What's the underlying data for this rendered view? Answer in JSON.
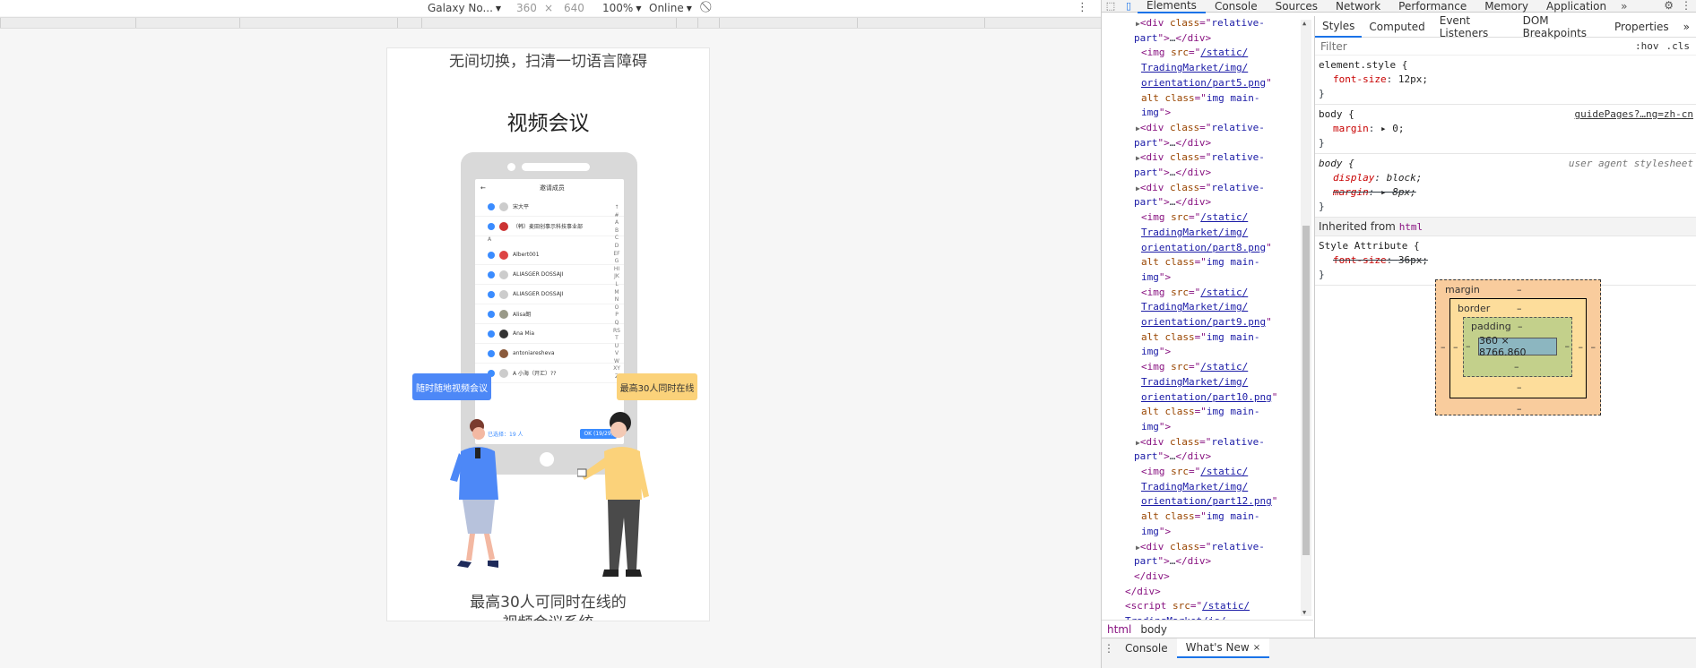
{
  "device_toolbar": {
    "device": "Galaxy No...",
    "width": "360",
    "times": "×",
    "height": "640",
    "zoom": "100%",
    "network": "Online"
  },
  "page": {
    "top_text": "无间切换，扫清一切语言障碍",
    "section_title": "视频会议",
    "bubble_left": "随时随地视频会议",
    "bubble_right": "最高30人同时在线",
    "bottom_line1": "最高30人可同时在线的",
    "bottom_line2": "视频会议系统",
    "mock_screen": {
      "header": "邀请成员",
      "rows": [
        "宋大平",
        "（韩）麦田创事示科技事业部",
        "Albert001",
        "ALIASGER DOSSAJI",
        "ALIASGER DOSSAJI",
        "Alisa朗",
        "Ana Mia",
        "antoniaresheva",
        "A 小海（开汇）??"
      ],
      "section_letter": "A",
      "index_letters": "↑#ABCDEFGHIJKLMNOPQRSTUVWXYZ",
      "footer_left": "已选择：19 人",
      "footer_ok": "OK (19/29)"
    }
  },
  "devtools": {
    "tabs": [
      "Elements",
      "Console",
      "Sources",
      "Network",
      "Performance",
      "Memory",
      "Application"
    ],
    "more": "»",
    "elements_lines": [
      {
        "indent": 1,
        "parts": [
          [
            "tri",
            "▶"
          ],
          [
            "tag",
            "<div "
          ],
          [
            "attr",
            "class"
          ],
          [
            "tag",
            "=\""
          ],
          [
            "val",
            "relative-"
          ]
        ]
      },
      {
        "indent": 0,
        "parts": [
          [
            "val",
            "part"
          ],
          [
            "tag",
            "\">"
          ],
          [
            "txt",
            "…"
          ],
          [
            "tag",
            "</div>"
          ]
        ]
      },
      {
        "indent": 2,
        "parts": [
          [
            "tag",
            "<img "
          ],
          [
            "attr",
            "src"
          ],
          [
            "tag",
            "=\""
          ],
          [
            "lnk",
            "/static/"
          ]
        ]
      },
      {
        "indent": 2,
        "parts": [
          [
            "lnk",
            "TradingMarket/img/"
          ]
        ]
      },
      {
        "indent": 2,
        "parts": [
          [
            "lnk",
            "orientation/part5.png"
          ],
          [
            "tag",
            "\""
          ]
        ]
      },
      {
        "indent": 2,
        "parts": [
          [
            "attr",
            "alt class"
          ],
          [
            "tag",
            "=\""
          ],
          [
            "val",
            "img main-"
          ]
        ]
      },
      {
        "indent": 2,
        "parts": [
          [
            "val",
            "img"
          ],
          [
            "tag",
            "\">"
          ]
        ]
      },
      {
        "indent": 1,
        "parts": [
          [
            "tri",
            "▶"
          ],
          [
            "tag",
            "<div "
          ],
          [
            "attr",
            "class"
          ],
          [
            "tag",
            "=\""
          ],
          [
            "val",
            "relative-"
          ]
        ]
      },
      {
        "indent": 0,
        "parts": [
          [
            "val",
            "part"
          ],
          [
            "tag",
            "\">"
          ],
          [
            "txt",
            "…"
          ],
          [
            "tag",
            "</div>"
          ]
        ]
      },
      {
        "indent": 1,
        "parts": [
          [
            "tri",
            "▶"
          ],
          [
            "tag",
            "<div "
          ],
          [
            "attr",
            "class"
          ],
          [
            "tag",
            "=\""
          ],
          [
            "val",
            "relative-"
          ]
        ]
      },
      {
        "indent": 0,
        "parts": [
          [
            "val",
            "part"
          ],
          [
            "tag",
            "\">"
          ],
          [
            "txt",
            "…"
          ],
          [
            "tag",
            "</div>"
          ]
        ]
      },
      {
        "indent": 1,
        "parts": [
          [
            "tri",
            "▶"
          ],
          [
            "tag",
            "<div "
          ],
          [
            "attr",
            "class"
          ],
          [
            "tag",
            "=\""
          ],
          [
            "val",
            "relative-"
          ]
        ]
      },
      {
        "indent": 0,
        "parts": [
          [
            "val",
            "part"
          ],
          [
            "tag",
            "\">"
          ],
          [
            "txt",
            "…"
          ],
          [
            "tag",
            "</div>"
          ]
        ]
      },
      {
        "indent": 2,
        "parts": [
          [
            "tag",
            "<img "
          ],
          [
            "attr",
            "src"
          ],
          [
            "tag",
            "=\""
          ],
          [
            "lnk",
            "/static/"
          ]
        ]
      },
      {
        "indent": 2,
        "parts": [
          [
            "lnk",
            "TradingMarket/img/"
          ]
        ]
      },
      {
        "indent": 2,
        "parts": [
          [
            "lnk",
            "orientation/part8.png"
          ],
          [
            "tag",
            "\""
          ]
        ]
      },
      {
        "indent": 2,
        "parts": [
          [
            "attr",
            "alt class"
          ],
          [
            "tag",
            "=\""
          ],
          [
            "val",
            "img main-"
          ]
        ]
      },
      {
        "indent": 2,
        "parts": [
          [
            "val",
            "img"
          ],
          [
            "tag",
            "\">"
          ]
        ]
      },
      {
        "indent": 2,
        "parts": [
          [
            "tag",
            "<img "
          ],
          [
            "attr",
            "src"
          ],
          [
            "tag",
            "=\""
          ],
          [
            "lnk",
            "/static/"
          ]
        ]
      },
      {
        "indent": 2,
        "parts": [
          [
            "lnk",
            "TradingMarket/img/"
          ]
        ]
      },
      {
        "indent": 2,
        "parts": [
          [
            "lnk",
            "orientation/part9.png"
          ],
          [
            "tag",
            "\""
          ]
        ]
      },
      {
        "indent": 2,
        "parts": [
          [
            "attr",
            "alt class"
          ],
          [
            "tag",
            "=\""
          ],
          [
            "val",
            "img main-"
          ]
        ]
      },
      {
        "indent": 2,
        "parts": [
          [
            "val",
            "img"
          ],
          [
            "tag",
            "\">"
          ]
        ]
      },
      {
        "indent": 2,
        "parts": [
          [
            "tag",
            "<img "
          ],
          [
            "attr",
            "src"
          ],
          [
            "tag",
            "=\""
          ],
          [
            "lnk",
            "/static/"
          ]
        ]
      },
      {
        "indent": 2,
        "parts": [
          [
            "lnk",
            "TradingMarket/img/"
          ]
        ]
      },
      {
        "indent": 2,
        "parts": [
          [
            "lnk",
            "orientation/part10.png"
          ],
          [
            "tag",
            "\""
          ]
        ]
      },
      {
        "indent": 2,
        "parts": [
          [
            "attr",
            "alt class"
          ],
          [
            "tag",
            "=\""
          ],
          [
            "val",
            "img main-"
          ]
        ]
      },
      {
        "indent": 2,
        "parts": [
          [
            "val",
            "img"
          ],
          [
            "tag",
            "\">"
          ]
        ]
      },
      {
        "indent": 1,
        "parts": [
          [
            "tri",
            "▶"
          ],
          [
            "tag",
            "<div "
          ],
          [
            "attr",
            "class"
          ],
          [
            "tag",
            "=\""
          ],
          [
            "val",
            "relative-"
          ]
        ]
      },
      {
        "indent": 0,
        "parts": [
          [
            "val",
            "part"
          ],
          [
            "tag",
            "\">"
          ],
          [
            "txt",
            "…"
          ],
          [
            "tag",
            "</div>"
          ]
        ]
      },
      {
        "indent": 2,
        "parts": [
          [
            "tag",
            "<img "
          ],
          [
            "attr",
            "src"
          ],
          [
            "tag",
            "=\""
          ],
          [
            "lnk",
            "/static/"
          ]
        ]
      },
      {
        "indent": 2,
        "parts": [
          [
            "lnk",
            "TradingMarket/img/"
          ]
        ]
      },
      {
        "indent": 2,
        "parts": [
          [
            "lnk",
            "orientation/part12.png"
          ],
          [
            "tag",
            "\""
          ]
        ]
      },
      {
        "indent": 2,
        "parts": [
          [
            "attr",
            "alt class"
          ],
          [
            "tag",
            "=\""
          ],
          [
            "val",
            "img main-"
          ]
        ]
      },
      {
        "indent": 2,
        "parts": [
          [
            "val",
            "img"
          ],
          [
            "tag",
            "\">"
          ]
        ]
      },
      {
        "indent": 1,
        "parts": [
          [
            "tri",
            "▶"
          ],
          [
            "tag",
            "<div "
          ],
          [
            "attr",
            "class"
          ],
          [
            "tag",
            "=\""
          ],
          [
            "val",
            "relative-"
          ]
        ]
      },
      {
        "indent": 0,
        "parts": [
          [
            "val",
            "part"
          ],
          [
            "tag",
            "\">"
          ],
          [
            "txt",
            "…"
          ],
          [
            "tag",
            "</div>"
          ]
        ]
      },
      {
        "indent": 0,
        "parts": [
          [
            "tag",
            "</div>"
          ]
        ]
      },
      {
        "indent": -1,
        "parts": [
          [
            "tag",
            "</div>"
          ]
        ]
      },
      {
        "indent": -1,
        "parts": [
          [
            "tag",
            "<script "
          ],
          [
            "attr",
            "src"
          ],
          [
            "tag",
            "=\""
          ],
          [
            "lnk",
            "/static/"
          ]
        ]
      },
      {
        "indent": -1,
        "parts": [
          [
            "lnk",
            "TradingMarket/js/"
          ]
        ]
      }
    ],
    "breadcrumbs": [
      "html",
      "body"
    ],
    "styles_tabs": [
      "Styles",
      "Computed",
      "Event Listeners",
      "DOM Breakpoints",
      "Properties",
      "»"
    ],
    "filter_placeholder": "Filter",
    "filter_hov": ":hov",
    "filter_cls": ".cls",
    "rules": {
      "element_style_sel": "element.style {",
      "element_style_prop": "font-size",
      "element_style_val": "12px;",
      "body1_sel": "body {",
      "body1_src": "guidePages?…ng=zh-cn",
      "body1_prop": "margin",
      "body1_val": "▸ 0;",
      "body2_sel": "body {",
      "body2_src": "user agent stylesheet",
      "body2_prop1": "display",
      "body2_val1": "block;",
      "body2_prop2": "margin",
      "body2_val2": "▸ 8px;",
      "close": "}",
      "inherited_label": "Inherited from",
      "inherited_tag": "html",
      "style_attr_sel": "Style Attribute {",
      "style_attr_prop": "font-size",
      "style_attr_val": "36px;"
    },
    "box_model": {
      "margin_label": "margin",
      "border_label": "border",
      "padding_label": "padding",
      "dash": "–",
      "content": "360 × 8766.860"
    },
    "drawer_tabs": [
      "Console",
      "What's New"
    ],
    "drawer_close": "×"
  }
}
